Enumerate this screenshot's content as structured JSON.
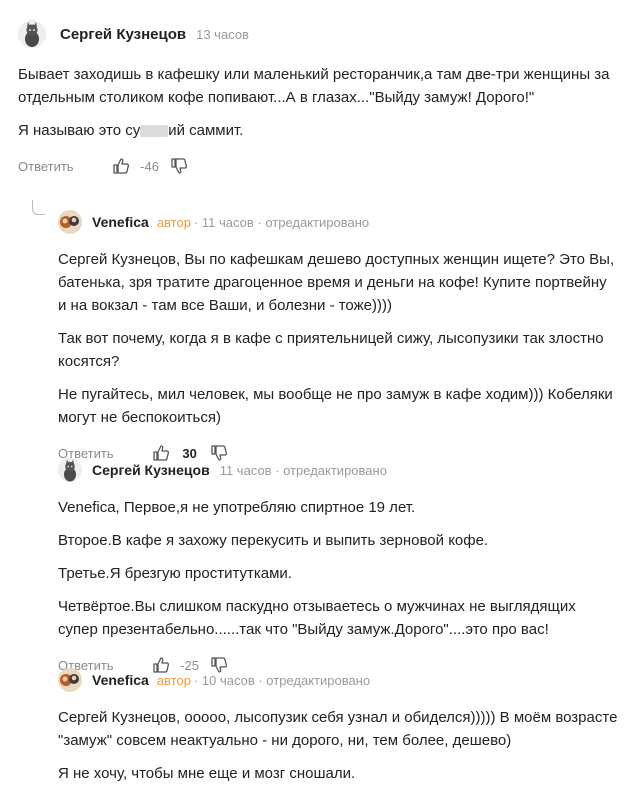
{
  "comments": [
    {
      "author": "Сергей Кузнецов",
      "time": "13 часов",
      "paragraphs": [
        "Бывает заходишь в кафешку или маленький ресторанчик,а там две-три женщины за отдельным столиком кофе попивают...А в глазах...\"Выйду замуж! Дорого!\"",
        "Я называю это су"
      ],
      "tail": "ий саммит.",
      "reply": "Ответить",
      "score": "-46",
      "avatar_icon": "cat-avatar"
    },
    {
      "author": "Venefica",
      "author_tag": "автор",
      "meta": "· 11 часов · отредактировано",
      "paragraphs": [
        "Сергей Кузнецов, Вы по кафешкам дешево доступных женщин ищете? Это Вы, батенька, зря тратите драгоценное время и деньги на кофе! Купите портвейну и на вокзал - там все Ваши, и болезни - тоже))))",
        "Так вот почему, когда я в кафе с приятельницей сижу, лысопузики так злостно косятся?",
        "Не пугайтесь, мил человек, мы вообще не про замуж в кафе ходим))) Кобеляки могут не беспокоиться)"
      ],
      "reply": "Ответить",
      "score": "30",
      "avatar_icon": "author-avatar"
    },
    {
      "author": "Сергей Кузнецов",
      "meta": "11 часов · отредактировано",
      "paragraphs": [
        "Venefica, Первое,я не употребляю спиртное 19 лет.",
        "Второе.В кафе я захожу перекусить и выпить зерновой кофе.",
        "Третье.Я брезгую проститутками.",
        "Четвёртое.Вы слишком паскудно отзываетесь о мужчинах не выглядящих супер презентабельно......так что \"Выйду замуж.Дорого\"....это про вас!"
      ],
      "reply": "Ответить",
      "score": "-25",
      "avatar_icon": "cat-avatar"
    },
    {
      "author": "Venefica",
      "author_tag": "автор",
      "meta": "· 10 часов · отредактировано",
      "paragraphs": [
        "Сергей Кузнецов, ооооо, лысопузик себя узнал и обиделся))))) В моём возрасте \"замуж\" совсем неактуально - ни дорого, ни, тем более, дешево)",
        "Я не хочу, чтобы мне еще и мозг сношали."
      ],
      "avatar_icon": "author-avatar"
    }
  ],
  "icons": {
    "like": "thumb-up-icon",
    "dislike": "thumb-down-icon",
    "thread": "reply-thread-icon"
  },
  "colors": {
    "author_tag": "#f09a3a",
    "meta": "#9a9a9a"
  }
}
